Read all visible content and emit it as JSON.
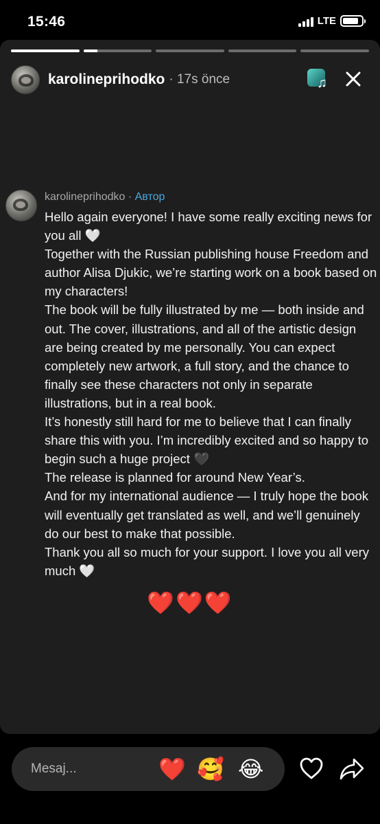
{
  "status_bar": {
    "time": "15:46",
    "network": "LTE",
    "signal_icon": "cellular-signal-icon",
    "battery_icon": "battery-icon",
    "battery_level": 0.85
  },
  "story": {
    "progress_segments": [
      1.0,
      0.2,
      0.0,
      0.0,
      0.0
    ],
    "username": "karolineprihodko",
    "time_ago": "· 17s önce",
    "music_icon": "music-sticker-icon",
    "close_icon": "close-icon"
  },
  "post": {
    "username": "karolineprihodko",
    "separator": " · ",
    "author_badge": "Автор",
    "text": "Hello again everyone! I have some really exciting news for you all 🤍\nTogether with the Russian publishing house Freedom and author Alisa Djukic, we’re starting work on a book based on my characters!\nThe book will be fully illustrated by me — both inside and out. The cover, illustrations, and all of the artistic design are being created by me personally. You can expect completely new artwork, a full story, and the chance to finally see these characters not only in separate illustrations, but in a real book.\nIt’s honestly still hard for me to believe that I can finally share this with you. I’m incredibly excited and so happy to begin such a huge project 🖤\nThe release is planned for around New Year’s.\nAnd for my international audience — I truly hope the book will eventually get translated as well, and we’ll genuinely do our best to make that possible.\nThank you all so much for your support. I love you all very much 🤍",
    "hearts": "❤️❤️❤️"
  },
  "bottom_bar": {
    "message_placeholder": "Mesaj...",
    "quick_reactions": [
      "❤️",
      "🥰",
      "😂"
    ],
    "like_icon": "heart-outline-icon",
    "share_icon": "share-arrow-icon"
  }
}
